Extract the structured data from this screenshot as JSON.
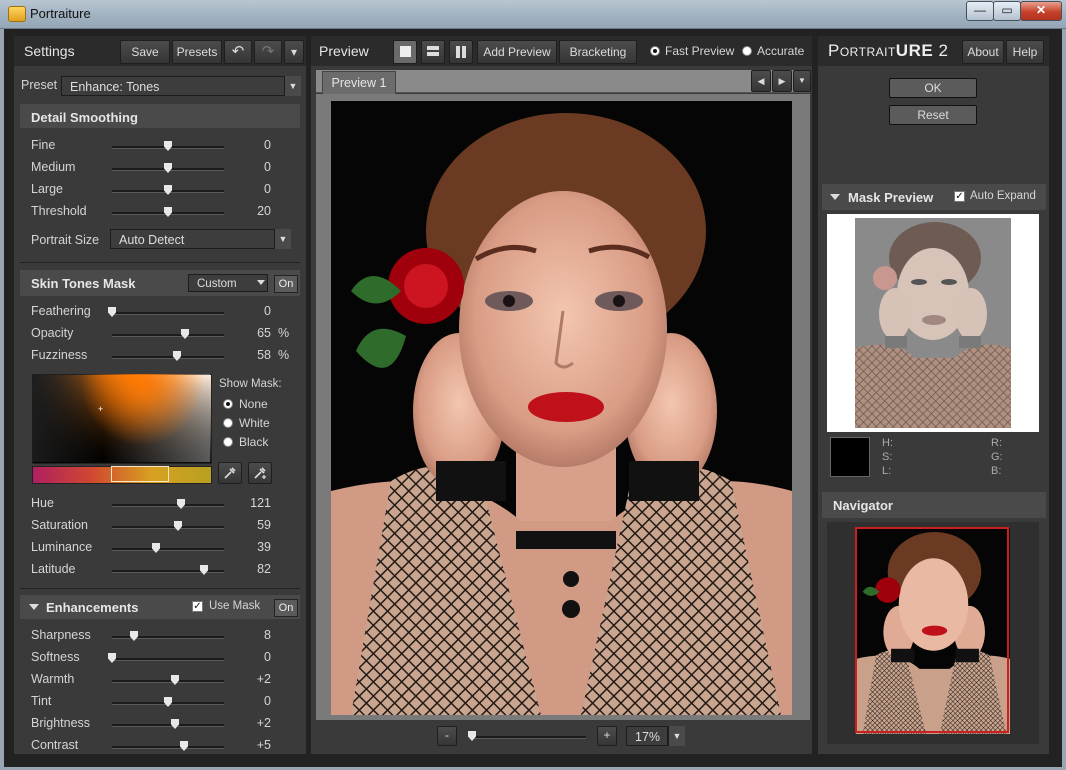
{
  "window": {
    "title": "Portraiture",
    "min": "—",
    "max": "▭",
    "close": "✕"
  },
  "settings": {
    "title": "Settings",
    "save": "Save",
    "presets": "Presets",
    "undo": "↶",
    "redo": "↷",
    "menu": "▾",
    "preset_label": "Preset",
    "preset_value": "Enhance: Tones"
  },
  "detail": {
    "title": "Detail Smoothing",
    "rows": [
      {
        "label": "Fine",
        "value": "0",
        "pos": 0.5
      },
      {
        "label": "Medium",
        "value": "0",
        "pos": 0.5
      },
      {
        "label": "Large",
        "value": "0",
        "pos": 0.5
      },
      {
        "label": "Threshold",
        "value": "20",
        "pos": 0.5
      }
    ],
    "portrait_size_label": "Portrait Size",
    "portrait_size_value": "Auto Detect"
  },
  "skin": {
    "title": "Skin Tones Mask",
    "mode": "Custom",
    "on": "On",
    "rows": [
      {
        "label": "Feathering",
        "value": "0",
        "unit": "",
        "pos": 0.0
      },
      {
        "label": "Opacity",
        "value": "65",
        "unit": "%",
        "pos": 0.65
      },
      {
        "label": "Fuzziness",
        "value": "58",
        "unit": "%",
        "pos": 0.58
      }
    ],
    "show_mask_label": "Show Mask:",
    "mask_options": [
      "None",
      "White",
      "Black"
    ],
    "mask_selected": "None",
    "tone_rows": [
      {
        "label": "Hue",
        "value": "121",
        "pos": 0.62
      },
      {
        "label": "Saturation",
        "value": "59",
        "pos": 0.59
      },
      {
        "label": "Luminance",
        "value": "39",
        "pos": 0.39
      },
      {
        "label": "Latitude",
        "value": "82",
        "pos": 0.82
      }
    ]
  },
  "enh": {
    "title": "Enhancements",
    "use_mask": "Use Mask",
    "on": "On",
    "rows": [
      {
        "label": "Sharpness",
        "value": "8",
        "pos": 0.2
      },
      {
        "label": "Softness",
        "value": "0",
        "pos": 0.0
      },
      {
        "label": "Warmth",
        "value": "+2",
        "pos": 0.56
      },
      {
        "label": "Tint",
        "value": "0",
        "pos": 0.5
      },
      {
        "label": "Brightness",
        "value": "+2",
        "pos": 0.56
      },
      {
        "label": "Contrast",
        "value": "+5",
        "pos": 0.64
      }
    ]
  },
  "preview": {
    "title": "Preview",
    "add_preview": "Add Preview",
    "bracketing": "Bracketing",
    "fast": "Fast Preview",
    "accurate": "Accurate",
    "tab": "Preview 1",
    "zoom_minus": "-",
    "zoom_plus": "+",
    "zoom": "17%",
    "zoom_pos": 0.0
  },
  "right": {
    "logo_a": "Portrait",
    "logo_b": "ure",
    "logo_c": "2",
    "about": "About",
    "help": "Help",
    "ok": "OK",
    "reset": "Reset",
    "mask_preview": "Mask Preview",
    "auto_expand": "Auto Expand",
    "h": "H:",
    "s": "S:",
    "l": "L:",
    "r": "R:",
    "g": "G:",
    "b": "B:",
    "navigator": "Navigator"
  },
  "colors": {
    "accent_red": "#cc1f1f",
    "panel_bg": "#3a3a3a"
  }
}
